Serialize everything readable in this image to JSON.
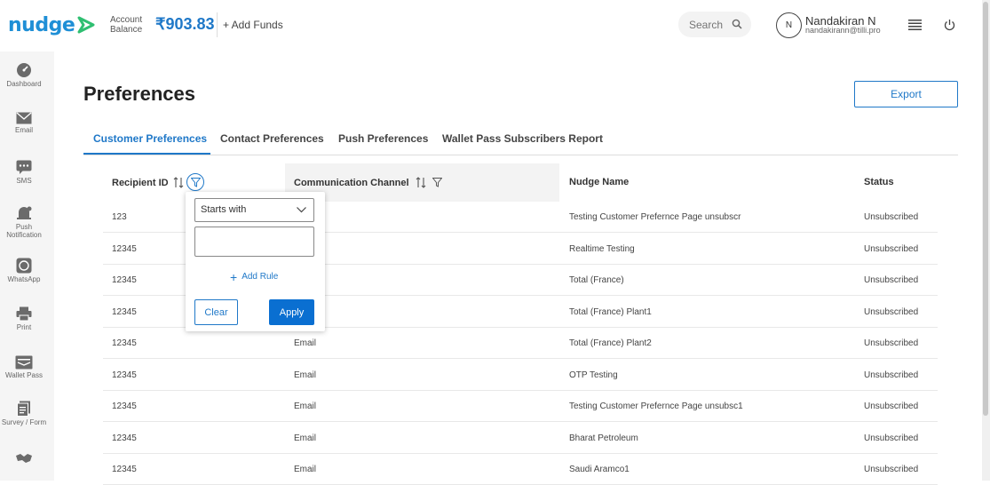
{
  "header": {
    "logo_text": "nudge",
    "account_label_line1": "Account",
    "account_label_line2": "Balance",
    "balance": "₹903.83",
    "add_funds": "+ Add Funds",
    "search_placeholder": "Search",
    "avatar_initial": "N",
    "user_name": "Nandakiran N",
    "user_email": "nandakirann@tilli.pro"
  },
  "sidebar": {
    "items": [
      {
        "label": "Dashboard",
        "icon": "dashboard-icon"
      },
      {
        "label": "Email",
        "icon": "email-icon"
      },
      {
        "label": "SMS",
        "icon": "sms-icon"
      },
      {
        "label": "Push Notification",
        "icon": "push-notification-icon"
      },
      {
        "label": "WhatsApp",
        "icon": "whatsapp-icon"
      },
      {
        "label": "Print",
        "icon": "print-icon"
      },
      {
        "label": "Wallet Pass",
        "icon": "wallet-pass-icon"
      },
      {
        "label": "Survey / Form",
        "icon": "survey-form-icon"
      },
      {
        "label": "",
        "icon": "handshake-icon"
      }
    ]
  },
  "page": {
    "title": "Preferences",
    "export_label": "Export"
  },
  "tabs": [
    {
      "label": "Customer Preferences",
      "active": true
    },
    {
      "label": "Contact Preferences",
      "active": false
    },
    {
      "label": "Push Preferences",
      "active": false
    },
    {
      "label": "Wallet Pass Subscribers Report",
      "active": false
    }
  ],
  "table": {
    "columns": [
      "Recipient ID",
      "Communication Channel",
      "Nudge Name",
      "Status"
    ],
    "rows": [
      [
        "123",
        "",
        "Testing Customer Prefernce Page unsubscr",
        "Unsubscribed"
      ],
      [
        "12345",
        "",
        "Realtime Testing",
        "Unsubscribed"
      ],
      [
        "12345",
        "",
        "Total (France)",
        "Unsubscribed"
      ],
      [
        "12345",
        "",
        "Total (France) Plant1",
        "Unsubscribed"
      ],
      [
        "12345",
        "Email",
        "Total (France) Plant2",
        "Unsubscribed"
      ],
      [
        "12345",
        "Email",
        "OTP Testing",
        "Unsubscribed"
      ],
      [
        "12345",
        "Email",
        "Testing Customer Prefernce Page unsubsc1",
        "Unsubscribed"
      ],
      [
        "12345",
        "Email",
        "Bharat Petroleum",
        "Unsubscribed"
      ],
      [
        "12345",
        "Email",
        "Saudi Aramco1",
        "Unsubscribed"
      ]
    ]
  },
  "filter_popup": {
    "operator": "Starts with",
    "value": "",
    "add_rule": "Add Rule",
    "clear": "Clear",
    "apply": "Apply"
  },
  "colors": {
    "accent": "#1f78c8",
    "brand_logo": "#1f8fd6",
    "apply_bg": "#0a6fd1"
  }
}
